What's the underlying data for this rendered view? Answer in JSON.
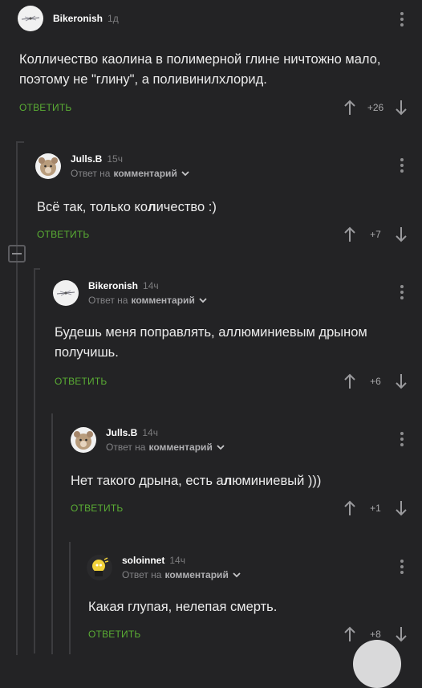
{
  "comments": [
    {
      "author": "Bikeronish",
      "time": "1д",
      "text": "Колличество каолина в полимерной глине ничтожно мало, поэтому не \"глину\", а поливинилхлорид.",
      "reply_label": "ОТВЕТИТЬ",
      "score": "+26",
      "avatar_icon": "propeller-sketch-avatar"
    },
    {
      "author": "Julls.B",
      "time": "15ч",
      "reply_prefix": "Ответ на",
      "reply_target": "комментарий",
      "text_before": "Всё так, только ко",
      "text_bold": "л",
      "text_after": "ичество :)",
      "reply_label": "ОТВЕТИТЬ",
      "score": "+7",
      "avatar_icon": "bear-avatar"
    },
    {
      "author": "Bikeronish",
      "time": "14ч",
      "reply_prefix": "Ответ на",
      "reply_target": "комментарий",
      "text": "Будешь меня поправлять, аллюминиевым дрыном получишь.",
      "reply_label": "ОТВЕТИТЬ",
      "score": "+6",
      "avatar_icon": "propeller-sketch-avatar"
    },
    {
      "author": "Julls.B",
      "time": "14ч",
      "reply_prefix": "Ответ на",
      "reply_target": "комментарий",
      "text_before": "Нет такого дрына, есть а",
      "text_bold": "л",
      "text_after": "юминиевый )))",
      "reply_label": "ОТВЕТИТЬ",
      "score": "+1",
      "avatar_icon": "bear-avatar"
    },
    {
      "author": "soloinnet",
      "time": "14ч",
      "reply_prefix": "Ответ на",
      "reply_target": "комментарий",
      "text": "Какая глупая, нелепая смерть.",
      "reply_label": "ОТВЕТИТЬ",
      "score": "+8",
      "avatar_icon": "homer-avatar"
    }
  ],
  "colors": {
    "background": "#232325",
    "reply_button": "#5aad34",
    "thread_line": "#3c3c3f"
  }
}
